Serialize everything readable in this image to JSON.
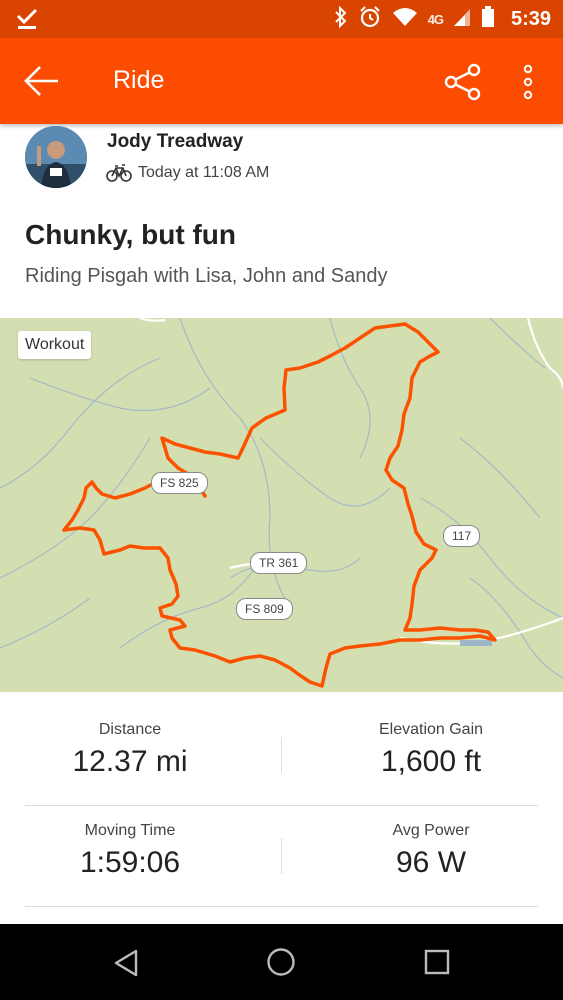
{
  "status_bar": {
    "network": "4G",
    "time": "5:39"
  },
  "app_bar": {
    "title": "Ride"
  },
  "activity": {
    "athlete_name": "Jody Treadway",
    "timestamp": "Today at 11:08 AM",
    "title": "Chunky, but fun",
    "description": "Riding Pisgah with Lisa, John and Sandy"
  },
  "map": {
    "badge": "Workout",
    "road_labels": {
      "fs825": "FS 825",
      "tr361": "TR 361",
      "fs809": "FS 809",
      "r117": "117"
    },
    "colors": {
      "route": "#fc5200",
      "land": "#d3dfb1",
      "water": "#9fb6c9"
    }
  },
  "stats": [
    {
      "label": "Distance",
      "value": "12.37 mi"
    },
    {
      "label": "Elevation Gain",
      "value": "1,600 ft"
    },
    {
      "label": "Moving Time",
      "value": "1:59:06"
    },
    {
      "label": "Avg Power",
      "value": "96 W"
    }
  ],
  "colors": {
    "brand": "#fc4c02",
    "status_bar": "#d94500"
  }
}
